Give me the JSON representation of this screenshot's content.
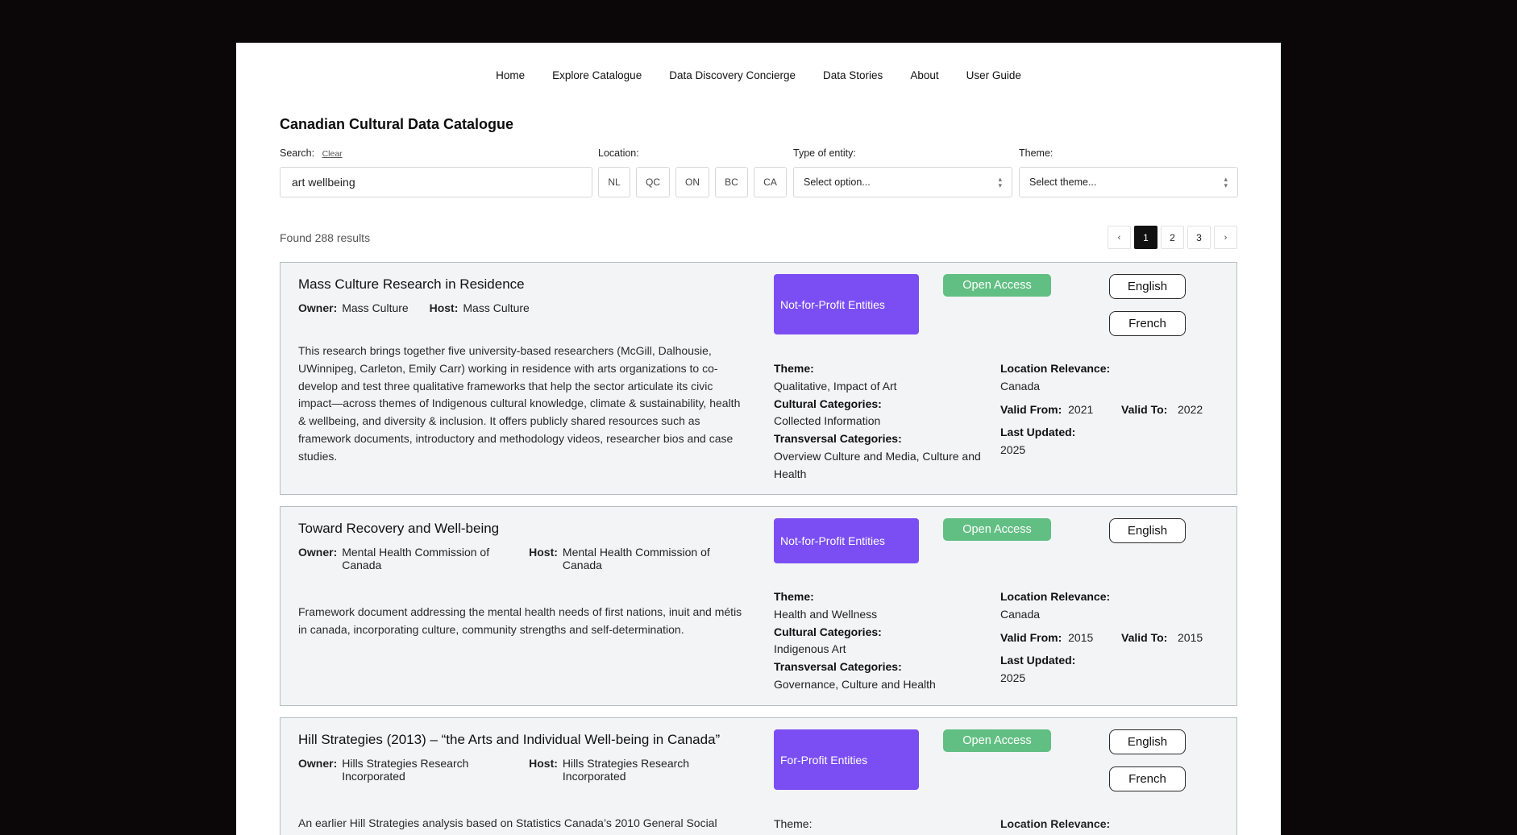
{
  "nav": [
    {
      "label": "Home"
    },
    {
      "label": "Explore Catalogue"
    },
    {
      "label": "Data Discovery Concierge"
    },
    {
      "label": "Data Stories"
    },
    {
      "label": "About"
    },
    {
      "label": "User Guide"
    }
  ],
  "title": "Canadian Cultural Data Catalogue",
  "filters": {
    "search_label": "Search:",
    "clear": "Clear",
    "search_value": "art wellbeing",
    "location_label": "Location:",
    "locations": [
      "NL",
      "QC",
      "ON",
      "BC",
      "CA"
    ],
    "entity_label": "Type of entity:",
    "entity_value": "Select option...",
    "theme_label": "Theme:",
    "theme_value": "Select theme..."
  },
  "results": {
    "found": "Found 288 results",
    "pager": {
      "prev": "‹",
      "pages": [
        "1",
        "2",
        "3"
      ],
      "active": "1",
      "next": "›"
    }
  },
  "labels": {
    "owner": "Owner:",
    "host": "Host:",
    "theme": "Theme:",
    "cultural": "Cultural Categories:",
    "transversal": "Transversal Categories:",
    "location": "Location Relevance:",
    "valid_from": "Valid From:",
    "valid_to": "Valid To:",
    "last_updated": "Last Updated:"
  },
  "cards": [
    {
      "title": "Mass Culture Research in Residence",
      "owner": "Mass Culture",
      "host": "Mass Culture",
      "entity": "Not-for-Profit Entities",
      "access": "Open Access",
      "languages": [
        "English",
        "French"
      ],
      "description": "This research brings together five university-based researchers (McGill, Dalhousie, UWinnipeg, Carleton, Emily Carr) working in residence with arts organizations to co-develop and test three qualitative frameworks that help the sector articulate its civic impact—across themes of Indigenous cultural knowledge, climate & sustainability, health & wellbeing, and diversity & inclusion. It offers publicly shared resources such as framework documents, introductory and methodology videos, researcher bios and case studies.",
      "theme": "Qualitative, Impact of Art",
      "cultural": "Collected Information",
      "transversal": "Overview Culture and Media, Culture and Health",
      "location": "Canada",
      "valid_from": "2021",
      "valid_to": "2022",
      "last_updated": "2025"
    },
    {
      "title": "Toward Recovery and Well-being",
      "owner": "Mental Health Commission of Canada",
      "host": "Mental Health Commission of Canada",
      "entity": "Not-for-Profit Entities",
      "access": "Open Access",
      "languages": [
        "English"
      ],
      "description": "Framework document addressing the mental health needs of first nations, inuit and métis in canada, incorporating culture, community strengths and self-determination.",
      "theme": "Health and Wellness",
      "cultural": "Indigenous Art",
      "transversal": "Governance, Culture and Health",
      "location": "Canada",
      "valid_from": "2015",
      "valid_to": "2015",
      "last_updated": "2025"
    },
    {
      "title": "Hill Strategies (2013) – “the Arts and Individual Well-being in Canada”",
      "owner": "Hills Strategies Research Incorporated",
      "host": "Hills Strategies Research Incorporated",
      "entity": "For-Profit Entities",
      "access": "Open Access",
      "languages": [
        "English",
        "French"
      ],
      "description": "An earlier Hill Strategies analysis based on Statistics Canada’s 2010 General Social"
    }
  ]
}
